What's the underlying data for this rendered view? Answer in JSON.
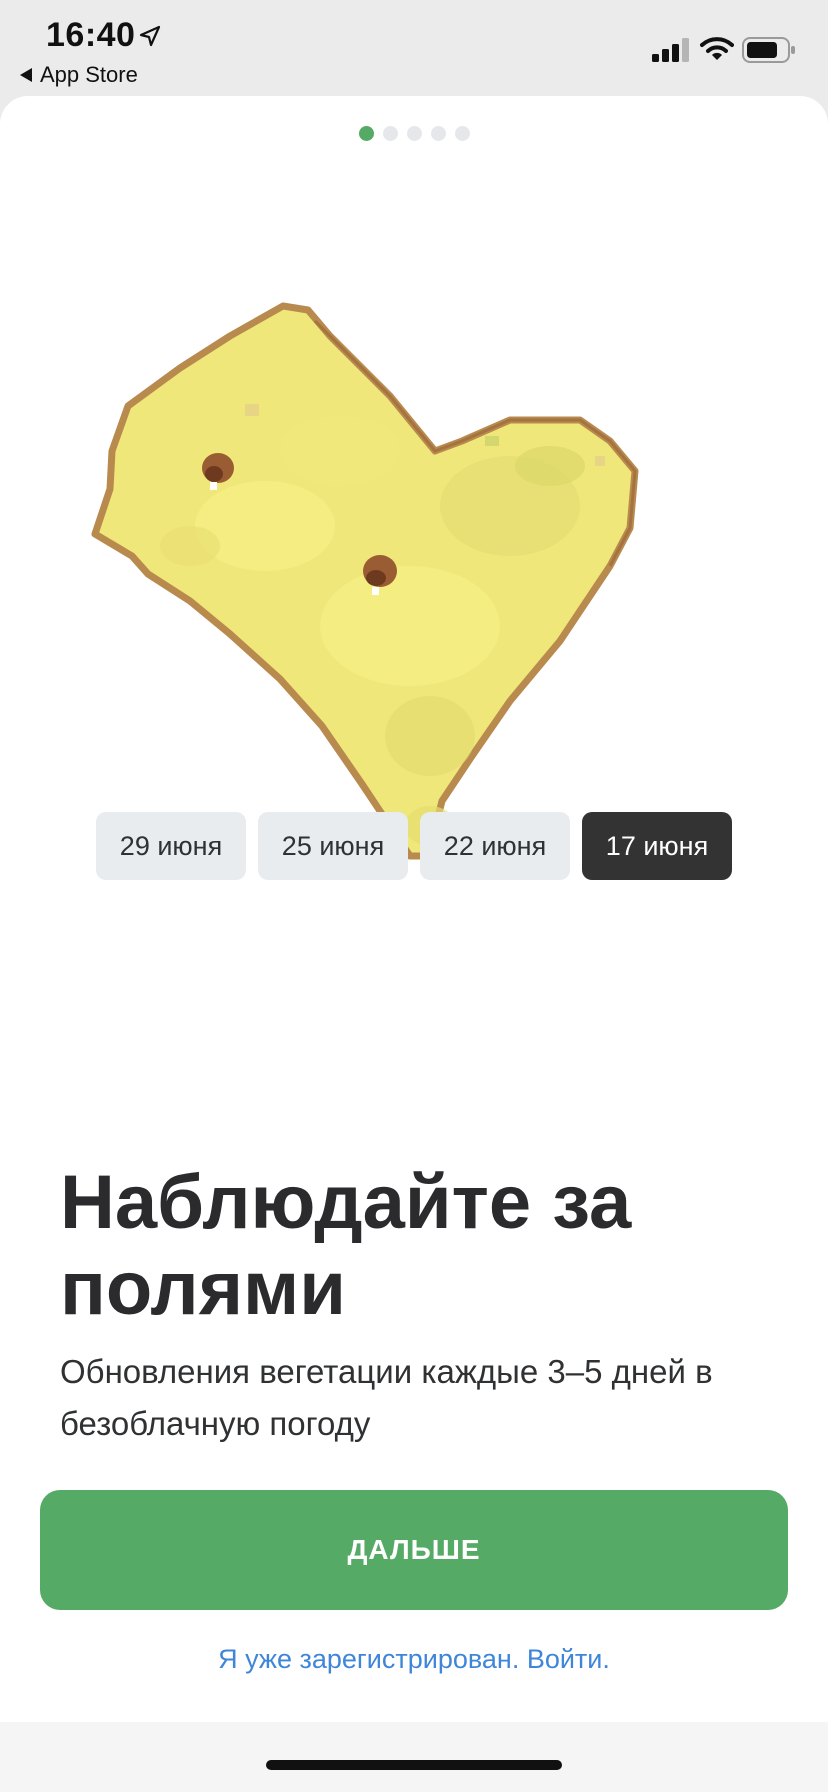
{
  "status_bar": {
    "time": "16:40",
    "back_app": "App Store",
    "icons": [
      "location-arrow-icon",
      "cellular-signal-icon",
      "wifi-icon",
      "battery-icon"
    ]
  },
  "pager": {
    "total": 5,
    "active_index": 0
  },
  "dates": [
    {
      "label": "29 июня",
      "selected": false
    },
    {
      "label": "25 июня",
      "selected": false
    },
    {
      "label": "22 июня",
      "selected": false
    },
    {
      "label": "17 июня",
      "selected": true
    }
  ],
  "headline": "Наблюдайте за полями",
  "subtitle": "Обновления вегетации каждые 3–5 дней в безоблачную погоду",
  "next_button": "ДАЛЬШЕ",
  "login_link": "Я уже зарегистрирован. Войти.",
  "colors": {
    "accent": "#55ab65",
    "link": "#3f86d8",
    "selected_chip": "#333333",
    "chip": "#e9ecef",
    "field_yellow": "#efe77a",
    "field_edge": "#b98a4e"
  }
}
